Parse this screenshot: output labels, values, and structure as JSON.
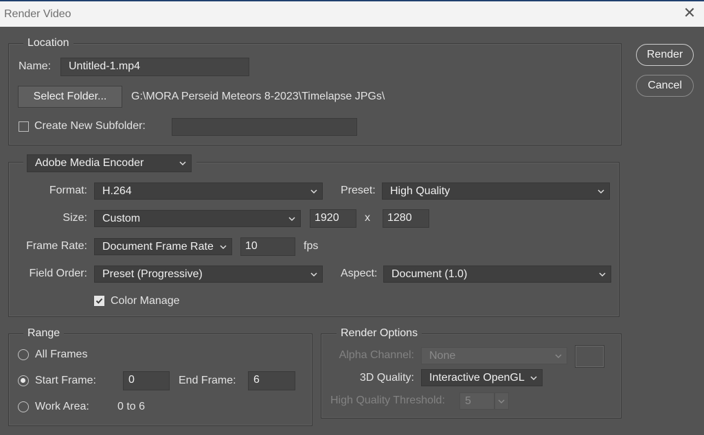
{
  "window": {
    "title": "Render Video",
    "close_glyph": "✕"
  },
  "buttons": {
    "render": "Render",
    "cancel": "Cancel"
  },
  "location": {
    "legend": "Location",
    "name_label": "Name:",
    "name_value": "Untitled-1.mp4",
    "select_folder": "Select Folder...",
    "folder_path": "G:\\MORA Perseid Meteors 8-2023\\Timelapse JPGs\\",
    "subfolder_label": "Create New Subfolder:",
    "subfolder_checked": false,
    "subfolder_value": ""
  },
  "encoder": {
    "selected": "Adobe Media Encoder",
    "format_label": "Format:",
    "format_value": "H.264",
    "preset_label": "Preset:",
    "preset_value": "High Quality",
    "size_label": "Size:",
    "size_value": "Custom",
    "width": "1920",
    "x_label": "x",
    "height": "1280",
    "framerate_label": "Frame Rate:",
    "framerate_value": "Document Frame Rate",
    "fps_value": "10",
    "fps_label": "fps",
    "fieldorder_label": "Field Order:",
    "fieldorder_value": "Preset (Progressive)",
    "aspect_label": "Aspect:",
    "aspect_value": "Document (1.0)",
    "color_manage_label": "Color Manage",
    "color_manage_checked": true
  },
  "range": {
    "legend": "Range",
    "all_frames": "All Frames",
    "start_frame_label": "Start Frame:",
    "start_frame_value": "0",
    "end_frame_label": "End Frame:",
    "end_frame_value": "6",
    "work_area_label": "Work Area:",
    "work_area_value": "0 to 6",
    "selected": "start_frame"
  },
  "render_options": {
    "legend": "Render Options",
    "alpha_label": "Alpha Channel:",
    "alpha_value": "None",
    "quality_label": "3D Quality:",
    "quality_value": "Interactive OpenGL",
    "threshold_label": "High Quality Threshold:",
    "threshold_value": "5"
  },
  "colors": {
    "background": "#535353",
    "titlebar": "#f3f3f3",
    "field": "#454545"
  }
}
